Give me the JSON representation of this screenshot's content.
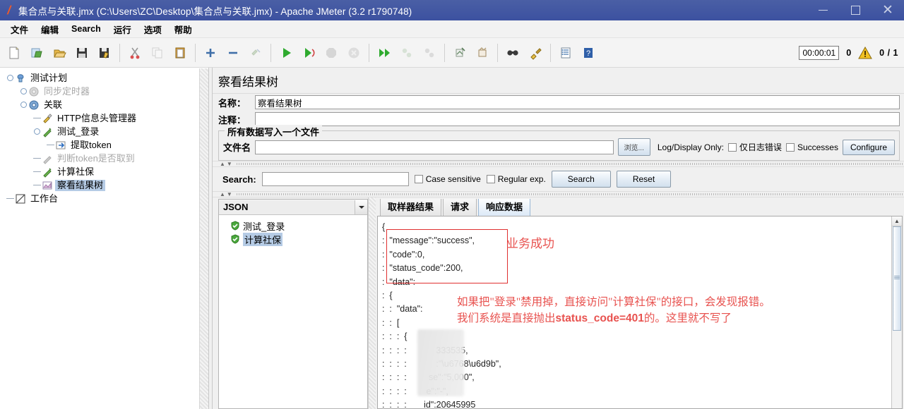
{
  "window": {
    "title": "集合点与关联.jmx (C:\\Users\\ZC\\Desktop\\集合点与关联.jmx) - Apache JMeter (3.2 r1790748)",
    "app_icon": "jmeter-feather-icon",
    "minimize": "–",
    "maximize": "□",
    "close": "✕",
    "titlebar_color": "#3c51a0"
  },
  "menubar": {
    "items": [
      {
        "label": "文件"
      },
      {
        "label": "编辑"
      },
      {
        "label": "Search"
      },
      {
        "label": "运行"
      },
      {
        "label": "选项"
      },
      {
        "label": "帮助"
      }
    ]
  },
  "toolbar": {
    "buttons": [
      {
        "name": "new-icon",
        "enabled": true
      },
      {
        "name": "templates-icon",
        "enabled": true
      },
      {
        "name": "open-icon",
        "enabled": true
      },
      {
        "name": "save-icon",
        "enabled": true
      },
      {
        "name": "save-as-icon",
        "enabled": true
      },
      {
        "name": "cut-icon",
        "enabled": true
      },
      {
        "name": "copy-icon",
        "enabled": false
      },
      {
        "name": "paste-icon",
        "enabled": true
      },
      {
        "name": "expand-icon",
        "enabled": true
      },
      {
        "name": "collapse-icon",
        "enabled": true
      },
      {
        "name": "toggle-icon",
        "enabled": false
      },
      {
        "name": "start-icon",
        "enabled": true
      },
      {
        "name": "start-no-pause-icon",
        "enabled": true
      },
      {
        "name": "stop-icon",
        "enabled": false
      },
      {
        "name": "shutdown-icon",
        "enabled": false
      },
      {
        "name": "start-remote-icon",
        "enabled": true
      },
      {
        "name": "stop-remote-icon",
        "enabled": false
      },
      {
        "name": "shutdown-remote-icon",
        "enabled": false
      },
      {
        "name": "clear-icon",
        "enabled": true
      },
      {
        "name": "clear-all-icon",
        "enabled": true
      },
      {
        "name": "search-icon",
        "enabled": true
      },
      {
        "name": "search-reset-icon",
        "enabled": true
      },
      {
        "name": "function-helper-icon",
        "enabled": true
      },
      {
        "name": "help-icon",
        "enabled": true
      }
    ],
    "elapsed_time": "00:00:01",
    "warning_count": "0",
    "warning_icon": "warning-triangle-icon",
    "thread_count": "0 / 1"
  },
  "tree": {
    "nodes": [
      {
        "label": "测试计划",
        "icon": "test-plan-icon",
        "indent": 0,
        "state": "normal",
        "has_handle": true
      },
      {
        "label": "同步定时器",
        "icon": "timer-icon",
        "indent": 1,
        "state": "disabled",
        "has_handle": true
      },
      {
        "label": "关联",
        "icon": "thread-group-icon",
        "indent": 1,
        "state": "normal",
        "has_handle": true
      },
      {
        "label": "HTTP信息头管理器",
        "icon": "header-manager-icon",
        "indent": 2,
        "state": "normal",
        "has_handle": false
      },
      {
        "label": "测试_登录",
        "icon": "http-sampler-icon",
        "indent": 2,
        "state": "normal",
        "has_handle": true
      },
      {
        "label": "提取token",
        "icon": "extractor-icon",
        "indent": 3,
        "state": "normal",
        "has_handle": false
      },
      {
        "label": "判断token是否取到",
        "icon": "assertion-icon",
        "indent": 2,
        "state": "disabled",
        "has_handle": false
      },
      {
        "label": "计算社保",
        "icon": "http-sampler-icon",
        "indent": 2,
        "state": "normal",
        "has_handle": false
      },
      {
        "label": "察看结果树",
        "icon": "view-results-tree-icon",
        "indent": 2,
        "state": "selected",
        "has_handle": false
      },
      {
        "label": "工作台",
        "icon": "workbench-icon",
        "indent": 0,
        "state": "normal",
        "has_handle": false
      }
    ]
  },
  "panel": {
    "title": "察看结果树",
    "name_label": "名称：",
    "name_value": "察看结果树",
    "comment_label": "注释：",
    "comment_value": "",
    "group_title": "所有数据写入一个文件",
    "filename_label": "文件名",
    "filename_value": "",
    "browse_button": "浏览...",
    "log_display_label": "Log/Display Only:",
    "errors_only_label": "仅日志错误",
    "successes_label": "Successes",
    "configure_button": "Configure"
  },
  "search_bar": {
    "label": "Search:",
    "value": "",
    "case_sensitive_label": "Case sensitive",
    "regular_exp_label": "Regular exp.",
    "search_button": "Search",
    "reset_button": "Reset"
  },
  "results": {
    "renderer_selected": "JSON",
    "items": [
      {
        "label": "测试_登录",
        "status": "success",
        "selected": false
      },
      {
        "label": "计算社保",
        "status": "success",
        "selected": true
      }
    ]
  },
  "response_tabs": [
    {
      "label": "取样器结果",
      "active": false
    },
    {
      "label": "请求",
      "active": false
    },
    {
      "label": "响应数据",
      "active": true
    }
  ],
  "response_json": {
    "lines": [
      "{",
      ":  \"message\":\"success\",",
      ":  \"code\":0,",
      ":  \"status_code\":200,",
      ":  \"data\":",
      ":  {",
      ":  :  \"data\":",
      ":  :  [",
      ":  :  :  {",
      ":  :  :  :            333535,",
      ":  :  :  :            :\"\\u6768\\u6d9b\",",
      ":  :  :  :         se\":\"5,000\",",
      ":  :  :  :        e\":\"-\",",
      ":  :  :  :       id\":20645995"
    ]
  },
  "annotations": {
    "success_note": "业务成功",
    "warning_line1": "如果把\"登录\"禁用掉，直接访问\"计算社保\"的接口，会发现报错。",
    "warning_line2_pre": "我们系统是直接抛出",
    "warning_line2_bold": "status_code=401",
    "warning_line2_post": "的。这里就不写了",
    "annotation_color": "#e8524f",
    "box_color": "#e03030"
  }
}
